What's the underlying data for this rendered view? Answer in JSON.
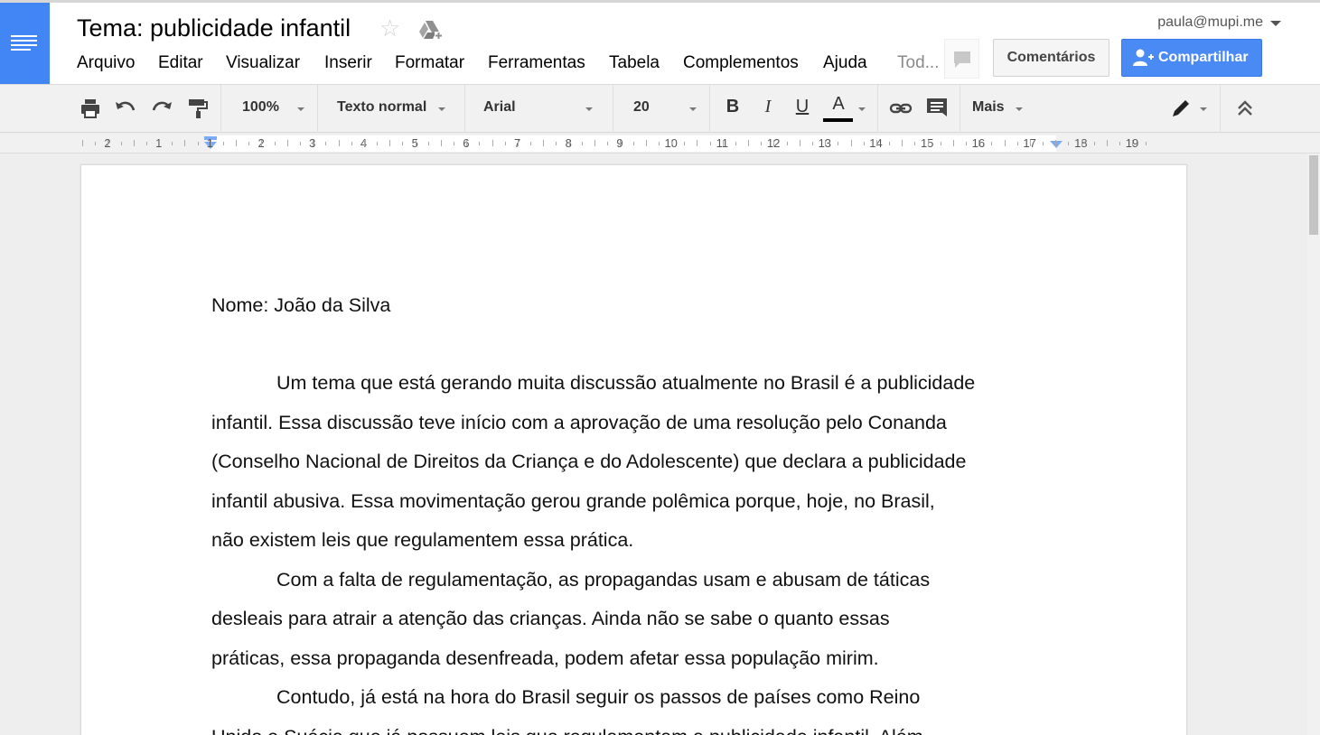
{
  "header": {
    "title": "Tema: publicidade infantil",
    "user_email": "paula@mupi.me",
    "comments_label": "Comentários",
    "share_label": "Compartilhar",
    "menu": [
      "Arquivo",
      "Editar",
      "Visualizar",
      "Inserir",
      "Formatar",
      "Ferramentas",
      "Tabela",
      "Complementos",
      "Ajuda",
      "Tod..."
    ]
  },
  "toolbar": {
    "zoom": "100%",
    "style": "Texto normal",
    "font": "Arial",
    "font_size": "20",
    "bold": "B",
    "italic": "I",
    "underline": "U",
    "text_color_letter": "A",
    "more": "Mais"
  },
  "ruler": {
    "numbers": [
      "2",
      "1",
      "1",
      "2",
      "3",
      "4",
      "5",
      "6",
      "7",
      "8",
      "9",
      "10",
      "11",
      "12",
      "13",
      "14",
      "15",
      "16",
      "17",
      "18",
      "19"
    ]
  },
  "document": {
    "name_line": "Nome: João da Silva",
    "paragraphs": [
      {
        "lines": [
          "Um tema que está gerando muita discussão atualmente no Brasil é a publicidade",
          "infantil. Essa discussão teve início com a aprovação de uma resolução pelo Conanda",
          "(Conselho Nacional de Direitos da Criança e do Adolescente) que declara a publicidade",
          "infantil abusiva. Essa movimentação gerou grande polêmica porque, hoje, no Brasil,",
          "não existem leis que regulamentem essa prática."
        ]
      },
      {
        "lines": [
          "Com a falta de regulamentação, as propagandas usam e abusam de táticas",
          "desleais para atrair a atenção das crianças. Ainda não se sabe o quanto essas",
          "práticas, essa propaganda desenfreada, podem afetar essa população mirim."
        ]
      },
      {
        "lines": [
          "Contudo, já está na hora do Brasil seguir os passos de países como Reino",
          "Unido e Suécia que já possuem leis que regulamentam a publicidade infantil. Além"
        ]
      }
    ]
  },
  "colors": {
    "brand_blue": "#4285f4",
    "share_blue": "#4a8af4"
  }
}
